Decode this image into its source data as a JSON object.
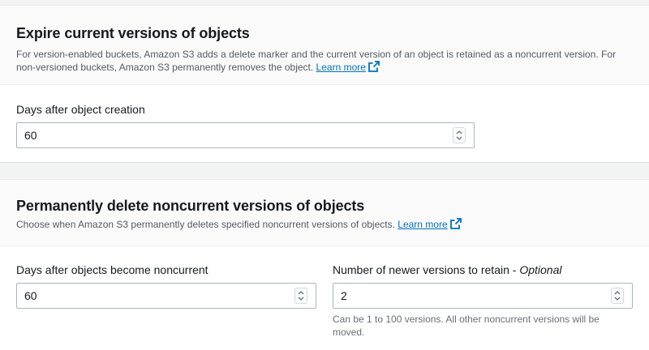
{
  "expire_section": {
    "title": "Expire current versions of objects",
    "description": "For version-enabled buckets, Amazon S3 adds a delete marker and the current version of an object is retained as a noncurrent version. For non-versioned buckets, Amazon S3 permanently removes the object.",
    "learn_more": "Learn more",
    "days_label": "Days after object creation",
    "days_value": "60"
  },
  "noncurrent_section": {
    "title": "Permanently delete noncurrent versions of objects",
    "description": "Choose when Amazon S3 permanently deletes specified noncurrent versions of objects.",
    "learn_more": "Learn more",
    "days_label": "Days after objects become noncurrent",
    "days_value": "60",
    "versions_label": "Number of newer versions to retain - ",
    "versions_optional": "Optional",
    "versions_value": "2",
    "versions_hint": "Can be 1 to 100 versions. All other noncurrent versions will be moved."
  },
  "icons": {
    "external_link": "external-link-icon",
    "spinner": "number-spinner-icon"
  },
  "colors": {
    "link": "#0073bb",
    "text": "#16191f",
    "secondary_text": "#545b64",
    "border": "#aab7b8"
  }
}
